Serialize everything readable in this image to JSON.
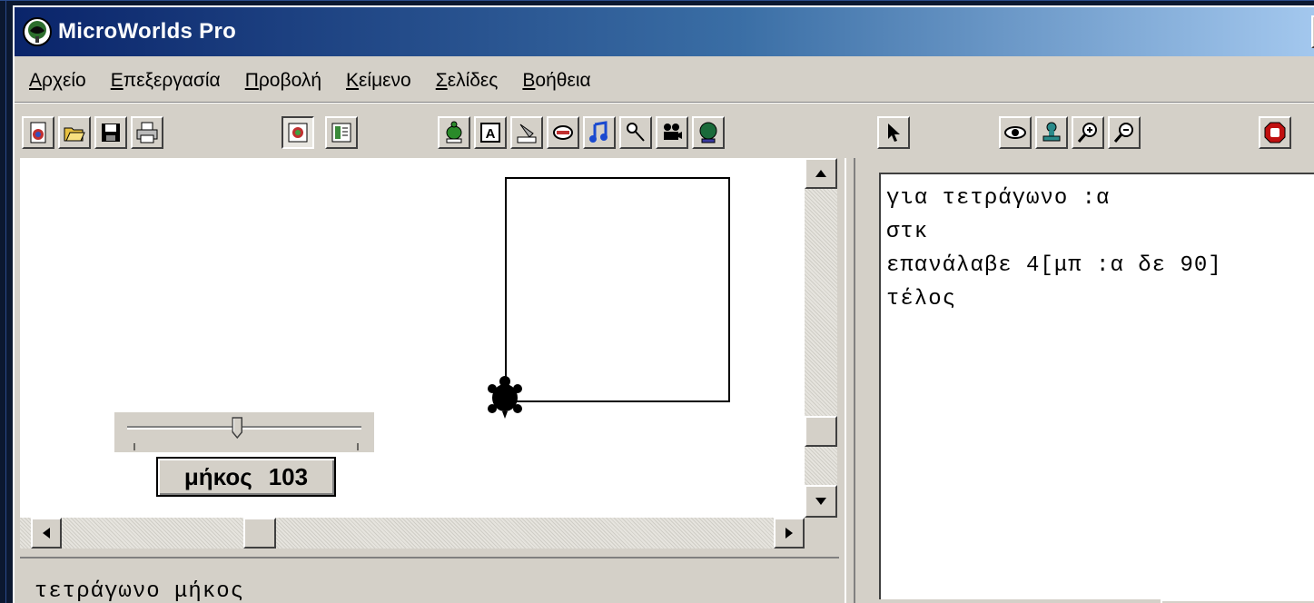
{
  "window": {
    "title": "MicroWorlds Pro"
  },
  "menu": [
    {
      "label": "Αρχείο",
      "accel": "Α",
      "rest": "ρχείο"
    },
    {
      "label": "Επεξεργασία",
      "accel": "Ε",
      "rest": "πεξεργασία"
    },
    {
      "label": "Προβολή",
      "accel": "Π",
      "rest": "ροβολή"
    },
    {
      "label": "Κείμενο",
      "accel": "Κ",
      "rest": "είμενο"
    },
    {
      "label": "Σελίδες",
      "accel": "Σ",
      "rest": "ελίδες"
    },
    {
      "label": "Βοήθεια",
      "accel": "Β",
      "rest": "οήθεια"
    }
  ],
  "toolbar_icons": [
    "new-project-icon",
    "open-icon",
    "save-icon",
    "print-icon",
    "page-view-icon",
    "text-view-icon",
    "turtle-icon",
    "text-box-icon",
    "button-icon",
    "slider-icon",
    "music-icon",
    "sound-icon",
    "video-icon",
    "shapes-icon",
    "pointer-icon",
    "eye-icon",
    "stamp-icon",
    "zoom-in-icon",
    "zoom-out-icon",
    "stop-icon"
  ],
  "slider": {
    "name": "μήκος",
    "value": "103",
    "level": 0.47
  },
  "procedures": {
    "lines": [
      "για τετράγωνο :α",
      "στκ",
      "επανάλαβε 4[μπ :α δε 90]",
      "τέλος"
    ]
  },
  "command_center": {
    "text": "τετράγωνο μήκος"
  },
  "colors": {
    "title_bar_start": "#0a246a",
    "title_bar_end": "#a6caf0",
    "chrome": "#d4d0c8"
  }
}
